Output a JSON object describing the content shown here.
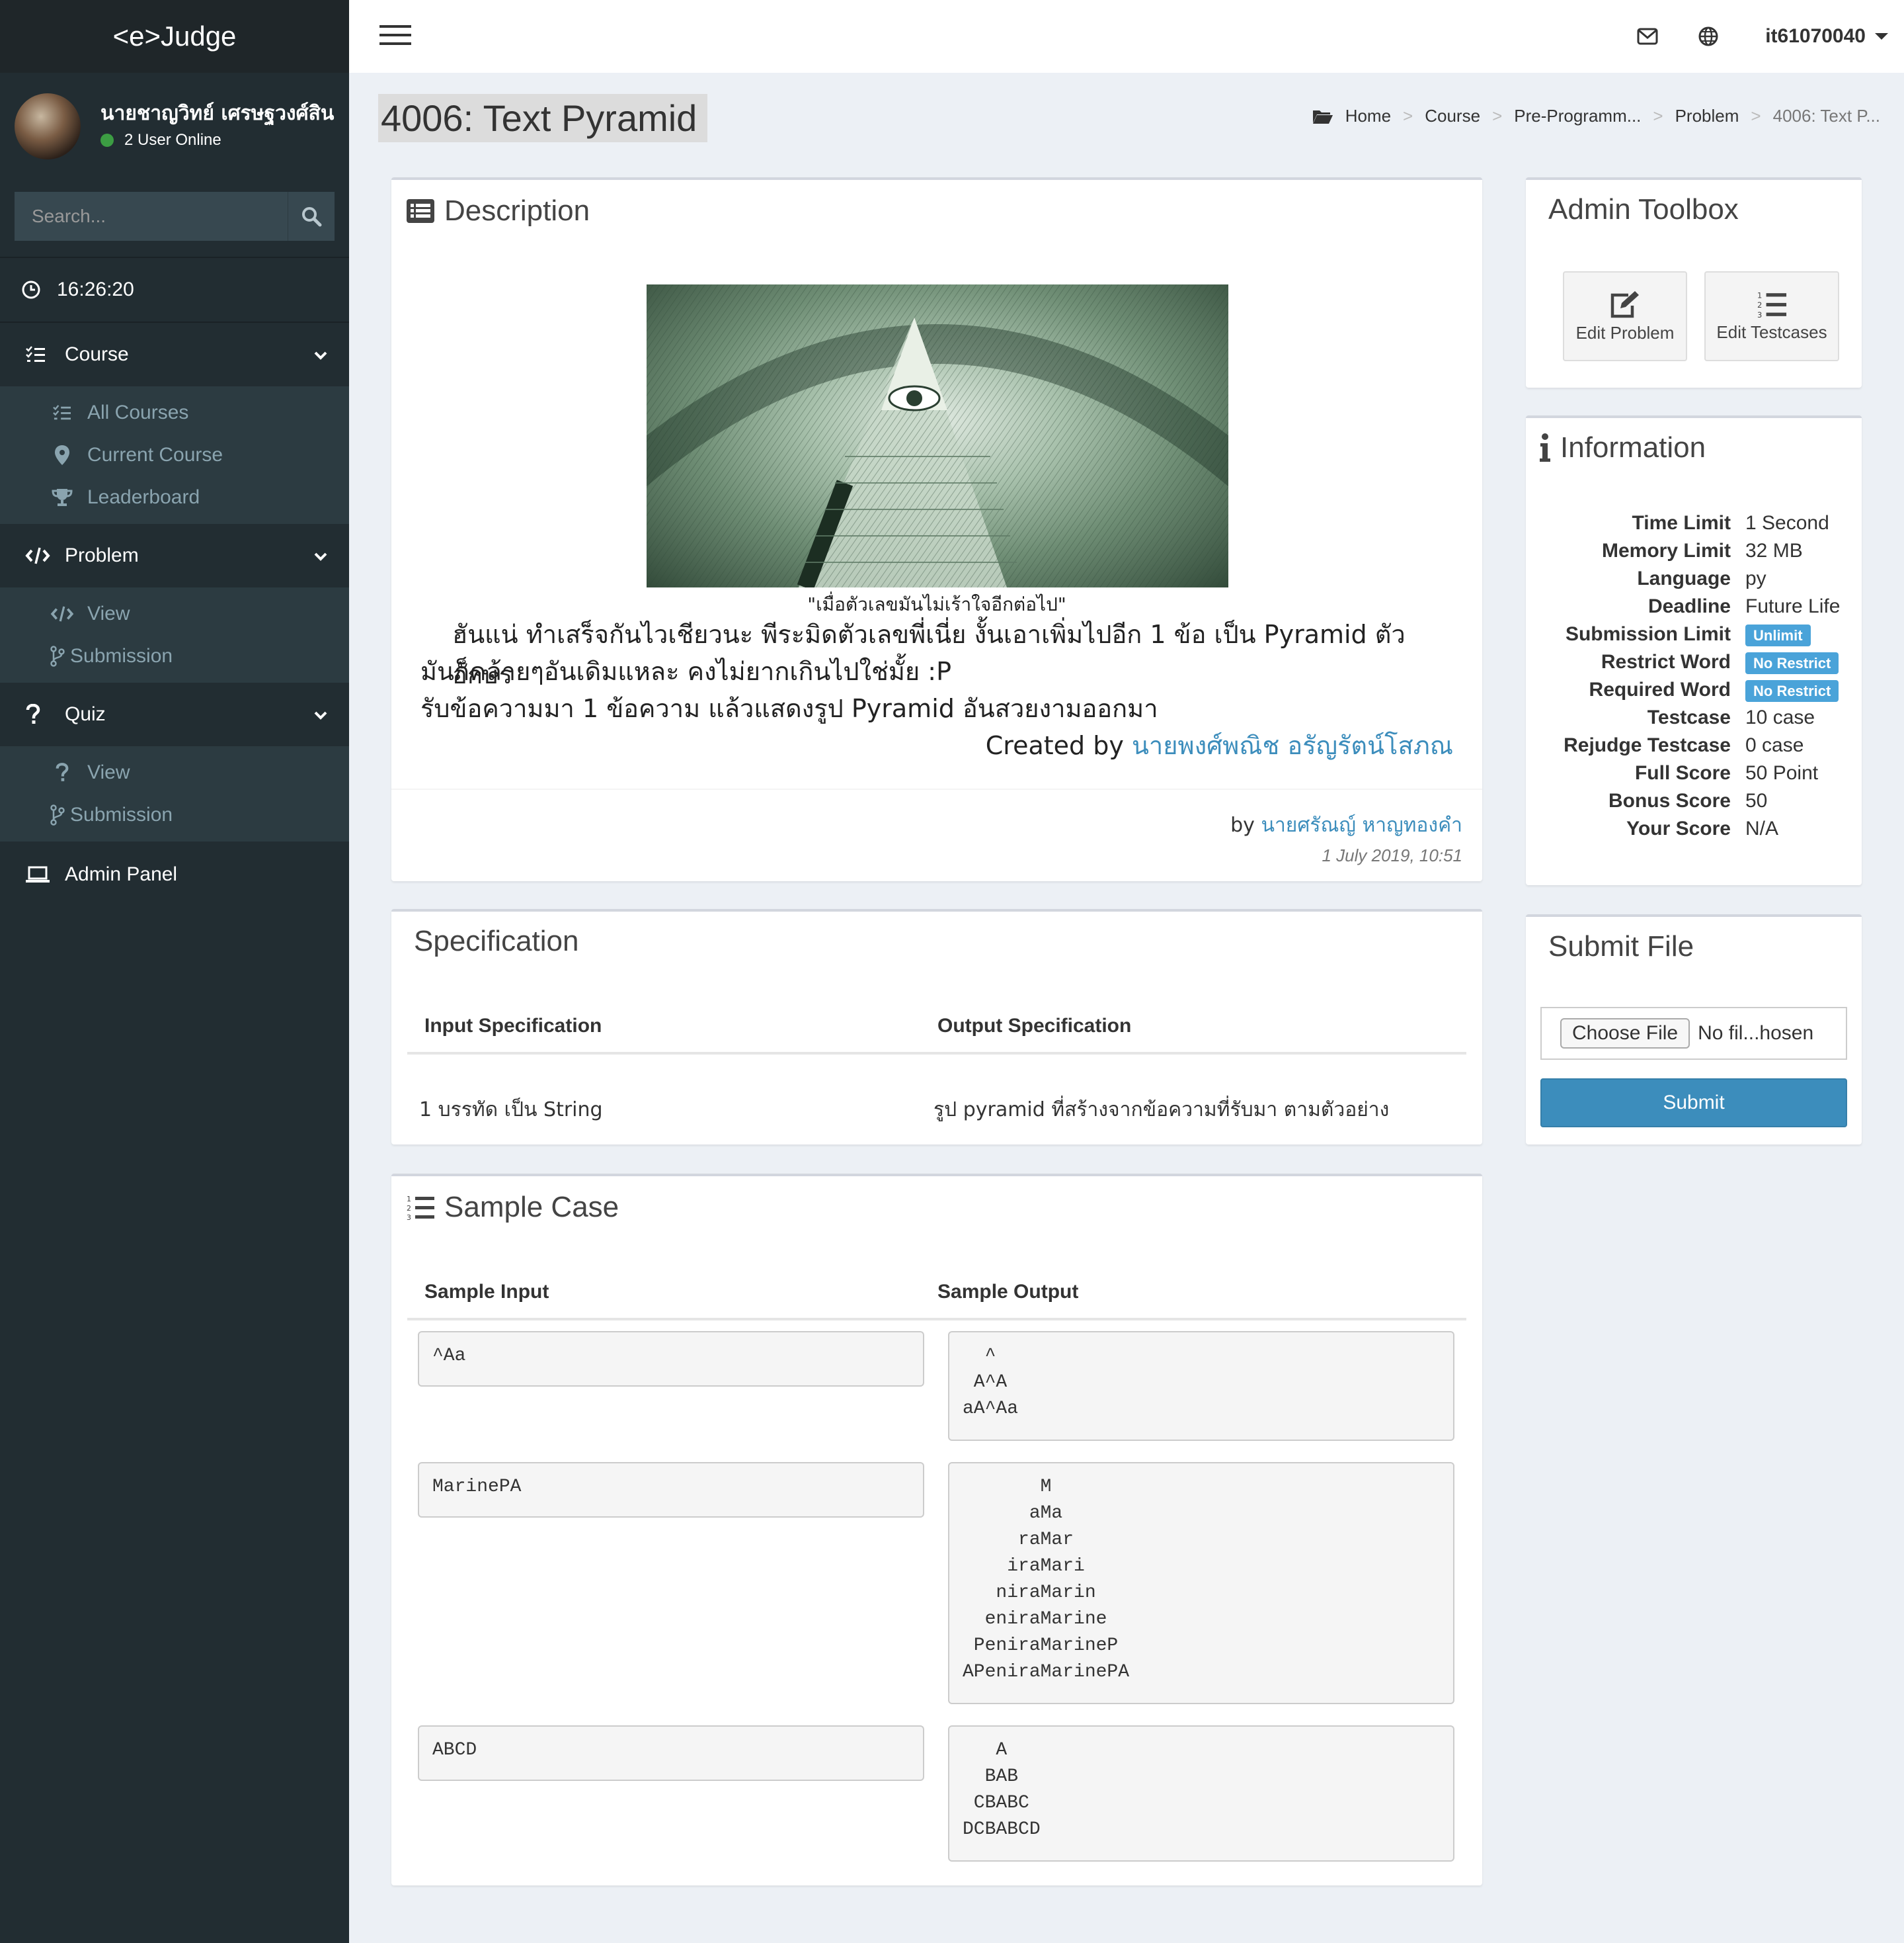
{
  "app": {
    "logo": "<e>Judge"
  },
  "user": {
    "name": "นายชาญวิทย์ เศรษฐวงศ์สิน",
    "online": "2 User Online"
  },
  "search": {
    "placeholder": "Search..."
  },
  "clock": "16:26:20",
  "sidebar": {
    "course": {
      "label": "Course",
      "items": [
        "All Courses",
        "Current Course",
        "Leaderboard"
      ]
    },
    "problem": {
      "label": "Problem",
      "items": [
        "View",
        "Submission"
      ]
    },
    "quiz": {
      "label": "Quiz",
      "items": [
        "View",
        "Submission"
      ]
    },
    "admin": "Admin Panel"
  },
  "topbar": {
    "username": "it61070040"
  },
  "page": {
    "title": "4006: Text Pyramid"
  },
  "breadcrumb": [
    "Home",
    "Course",
    "Pre-Programm...",
    "Problem",
    "4006: Text P..."
  ],
  "description": {
    "title": "Description",
    "caption": "\"เมื่อตัวเลขมันไม่เร้าใจอีกต่อไป\"",
    "line1": "ฮันแน่ ทำเสร็จกันไวเชียวนะ พีระมิดตัวเลขพี่เนี่ย งั้นเอาเพิ่มไปอีก 1 ข้อ เป็น Pyramid ตัวอักษร",
    "line2": "มันก็คล้ายๆอันเดิมแหละ คงไม่ยากเกินไปใช่มั้ย :P",
    "line3": "รับข้อความมา 1 ข้อความ แล้วแสดงรูป Pyramid อันสวยงามออกมา",
    "created_prefix": "Created by",
    "created_by": "นายพงศ์พณิช อรัญรัตน์โสภณ",
    "by_prefix": "by",
    "author": "นายศรัณญ์ หาญทองคำ",
    "date": "1 July 2019, 10:51"
  },
  "specification": {
    "title": "Specification",
    "input_header": "Input Specification",
    "output_header": "Output Specification",
    "input": "1 บรรทัด เป็น String",
    "output": "รูป pyramid ที่สร้างจากข้อความที่รับมา ตามตัวอย่าง"
  },
  "samples": {
    "title": "Sample Case",
    "input_header": "Sample Input",
    "output_header": "Sample Output",
    "cases": [
      {
        "input": "^Aa",
        "output": "  ^\n A^A\naA^Aa"
      },
      {
        "input": "MarinePA",
        "output": "       M\n      aMa\n     raMar\n    iraMari\n   niraMarin\n  eniraMarine\n PeniraMarineP\nAPeniraMarinePA"
      },
      {
        "input": "ABCD",
        "output": "   A\n  BAB\n CBABC\nDCBABCD"
      }
    ]
  },
  "toolbox": {
    "title": "Admin Toolbox",
    "edit_problem": "Edit Problem",
    "edit_testcases": "Edit Testcases"
  },
  "information": {
    "title": "Information",
    "rows": [
      {
        "label": "Time Limit",
        "value": "1 Second"
      },
      {
        "label": "Memory Limit",
        "value": "32 MB"
      },
      {
        "label": "Language",
        "value": "py"
      },
      {
        "label": "Deadline",
        "value": "Future Life"
      },
      {
        "label": "Submission Limit",
        "badge": "Unlimit"
      },
      {
        "label": "Restrict Word",
        "badge": "No Restrict"
      },
      {
        "label": "Required Word",
        "badge": "No Restrict"
      },
      {
        "label": "Testcase",
        "value": "10 case"
      },
      {
        "label": "Rejudge Testcase",
        "value": "0 case"
      },
      {
        "label": "Full Score",
        "value": "50 Point"
      },
      {
        "label": "Bonus Score",
        "value": "50"
      },
      {
        "label": "Your Score",
        "value": "N/A"
      }
    ]
  },
  "submit": {
    "title": "Submit File",
    "choose": "Choose File",
    "no_file": "No fil...hosen",
    "button": "Submit"
  },
  "colors": {
    "sidebar": "#222d32",
    "accent": "#3c8dbc",
    "badge": "#4aa3d9"
  }
}
